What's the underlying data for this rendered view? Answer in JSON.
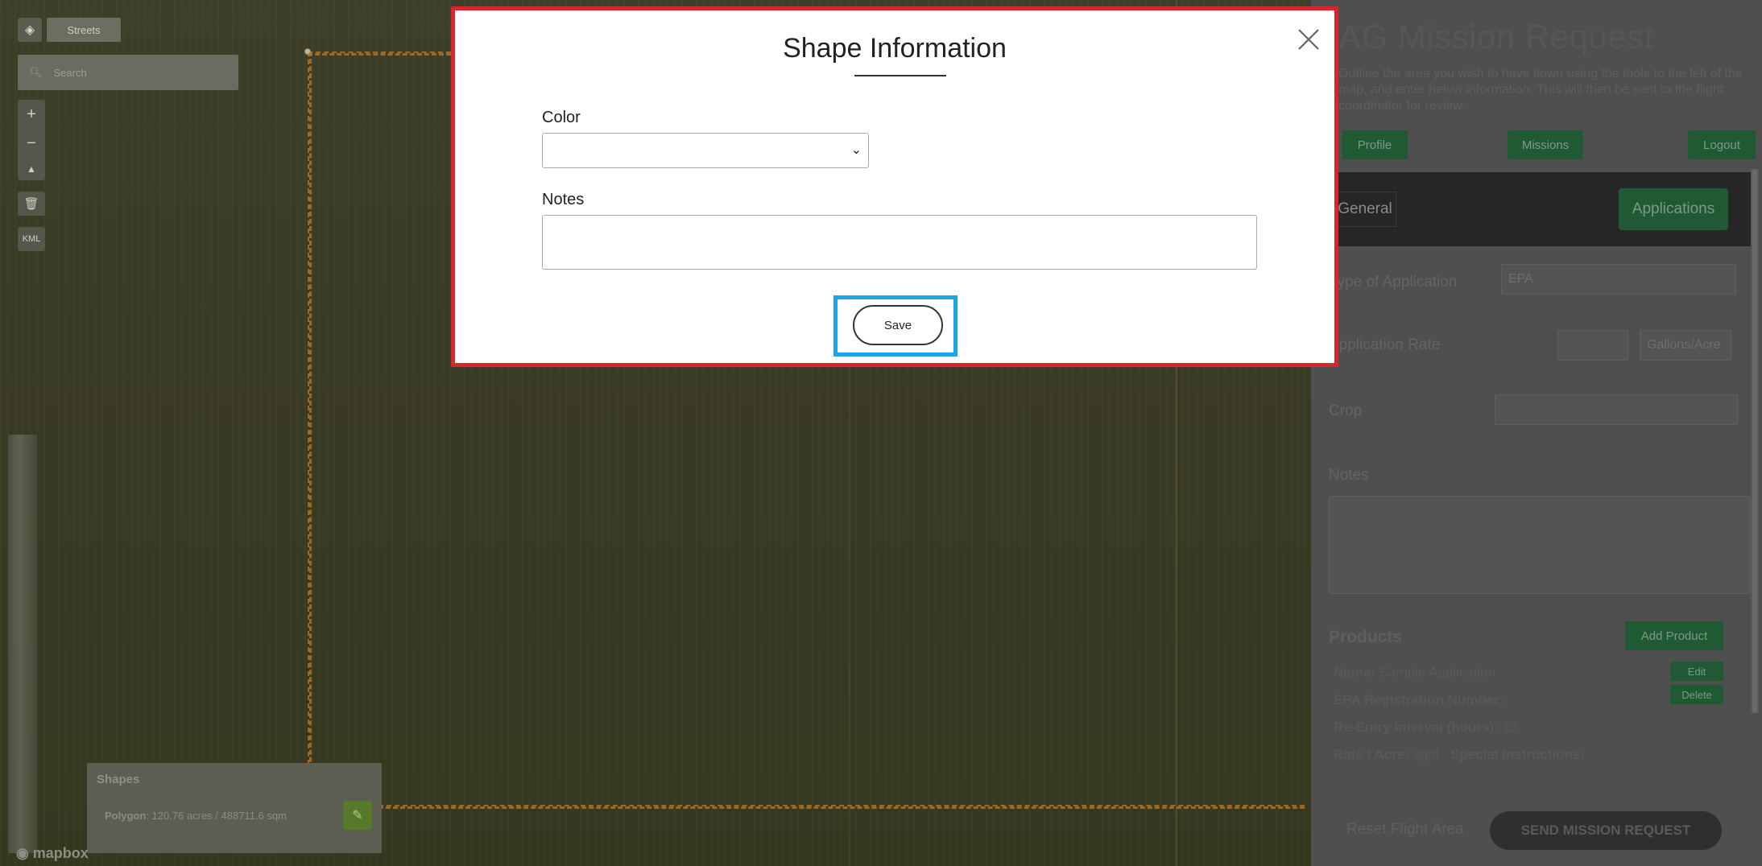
{
  "map": {
    "style_label": "Streets",
    "search_placeholder": "Search",
    "tools": {
      "zoom_in": "+",
      "zoom_out": "−",
      "compass": "▲",
      "trash": "🗑",
      "kml": "KML"
    },
    "shapes": {
      "title": "Shapes",
      "items": [
        {
          "type": "Polygon",
          "area": "120.76 acres / 488711.6 sqm"
        }
      ]
    },
    "attribution": "mapbox"
  },
  "side": {
    "title": "AG Mission Request",
    "description": "Outline the area you wish to have flown using the tools to the left of the map, and enter below information. This will then be sent to the flight coordinator for review.",
    "buttons": {
      "profile": "Profile",
      "missions": "Missions",
      "logout": "Logout"
    },
    "tabs": {
      "general": "General",
      "applications": "Applications"
    },
    "fields": {
      "type_label": "Type of Application",
      "type_value": "EPA",
      "rate_label": "Application Rate",
      "rate_value": "",
      "rate_unit": "Gallons/Acre",
      "crop_label": "Crop",
      "crop_value": "",
      "notes_label": "Notes"
    },
    "products": {
      "title": "Products",
      "add_label": "Add Product",
      "edit_label": "Edit",
      "delete_label": "Delete",
      "name_key": "Name:",
      "name_val": "Sample Application",
      "epa_key": "EPA Registration Number:",
      "epa_val": "",
      "rei_key": "Re-Entry Interval (hours):",
      "rei_val": "12",
      "rate_key": "Rate / Acre:",
      "rate_val": "3gal",
      "special_key": "Special Instructions:"
    },
    "reset_label": "Reset Flight Area",
    "send_label": "SEND MISSION REQUEST"
  },
  "modal": {
    "title": "Shape Information",
    "color_label": "Color",
    "color_value": "",
    "notes_label": "Notes",
    "notes_value": "",
    "save_label": "Save"
  },
  "colors": {
    "highlight_red": "#d9262e",
    "highlight_blue": "#1ba6e6",
    "button_green": "#1f5a34"
  }
}
